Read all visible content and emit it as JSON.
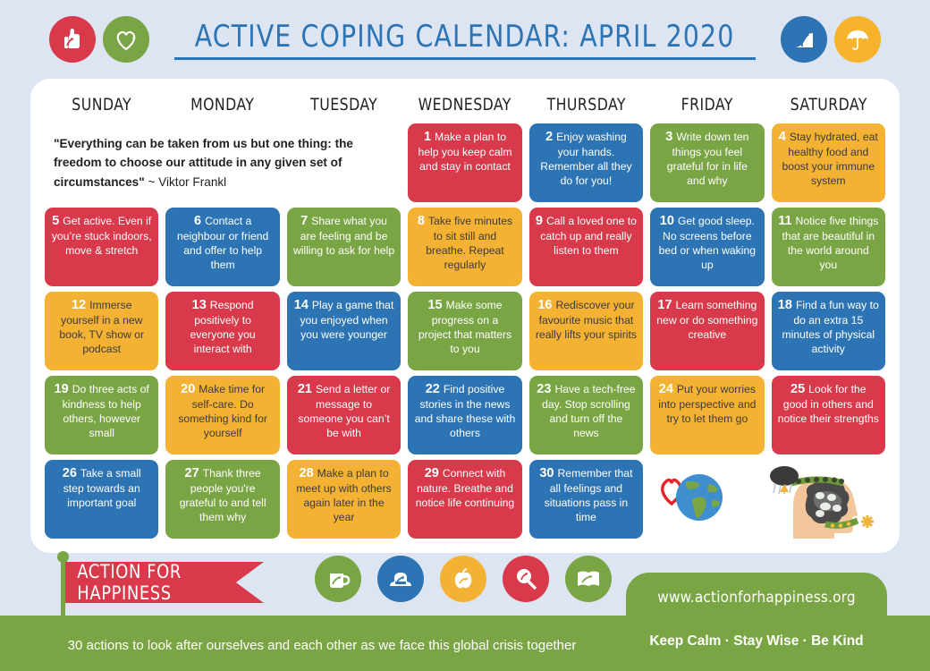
{
  "header": {
    "title": "ACTIVE COPING CALENDAR: APRIL 2020",
    "left_icons": [
      {
        "name": "thumbs-up-icon",
        "color": "#d8394b"
      },
      {
        "name": "heart-icon",
        "color": "#7aa545"
      }
    ],
    "right_icons": [
      {
        "name": "road-path-icon",
        "color": "#2d74b5"
      },
      {
        "name": "umbrella-icon",
        "color": "#f7b32b"
      }
    ]
  },
  "calendar": {
    "daynames": [
      "SUNDAY",
      "MONDAY",
      "TUESDAY",
      "WEDNESDAY",
      "THURSDAY",
      "FRIDAY",
      "SATURDAY"
    ],
    "quote": {
      "text": "\"Everything can be taken from us but one thing: the freedom to choose our attitude in any given set of circumstances\"",
      "author": "~ Viktor Frankl"
    },
    "days": [
      {
        "num": "1",
        "text": "Make a plan to help you keep calm and stay in contact",
        "color": "red"
      },
      {
        "num": "2",
        "text": "Enjoy washing your hands. Remember all they do for you!",
        "color": "blue"
      },
      {
        "num": "3",
        "text": "Write down ten things you feel grateful for in life and why",
        "color": "green"
      },
      {
        "num": "4",
        "text": "Stay hydrated, eat healthy food and boost your immune system",
        "color": "amber"
      },
      {
        "num": "5",
        "text": "Get active. Even if you’re stuck indoors, move & stretch",
        "color": "red"
      },
      {
        "num": "6",
        "text": "Contact a neighbour or friend and offer to help them",
        "color": "blue"
      },
      {
        "num": "7",
        "text": "Share what you are feeling and be willing to ask for help",
        "color": "green"
      },
      {
        "num": "8",
        "text": "Take five minutes to sit still and breathe. Repeat regularly",
        "color": "amber"
      },
      {
        "num": "9",
        "text": "Call a loved one to catch up and really listen to them",
        "color": "red"
      },
      {
        "num": "10",
        "text": "Get good sleep. No screens before bed or when waking up",
        "color": "blue"
      },
      {
        "num": "11",
        "text": "Notice five things that are beautiful in the world around you",
        "color": "green"
      },
      {
        "num": "12",
        "text": "Immerse yourself in a new book, TV show or podcast",
        "color": "amber"
      },
      {
        "num": "13",
        "text": "Respond positively to everyone you interact with",
        "color": "red"
      },
      {
        "num": "14",
        "text": "Play a game that you enjoyed when you were younger",
        "color": "blue"
      },
      {
        "num": "15",
        "text": "Make some progress on a project that matters to you",
        "color": "green"
      },
      {
        "num": "16",
        "text": "Rediscover your favourite music that really lifts your spirits",
        "color": "amber"
      },
      {
        "num": "17",
        "text": "Learn something new or do something creative",
        "color": "red"
      },
      {
        "num": "18",
        "text": "Find a fun way to do an extra 15 minutes of physical activity",
        "color": "blue"
      },
      {
        "num": "19",
        "text": "Do three acts of kindness to help others, however small",
        "color": "green"
      },
      {
        "num": "20",
        "text": "Make time for self-care. Do something kind for yourself",
        "color": "amber"
      },
      {
        "num": "21",
        "text": "Send a letter or message to someone you can’t be with",
        "color": "red"
      },
      {
        "num": "22",
        "text": "Find positive stories in the news and share these with others",
        "color": "blue"
      },
      {
        "num": "23",
        "text": "Have a tech-free day. Stop scrolling and turn off the news",
        "color": "green"
      },
      {
        "num": "24",
        "text": "Put your worries into perspective and try to let them go",
        "color": "amber"
      },
      {
        "num": "25",
        "text": "Look for the good in others and notice their strengths",
        "color": "red"
      },
      {
        "num": "26",
        "text": "Take a small step towards an important goal",
        "color": "blue"
      },
      {
        "num": "27",
        "text": "Thank three people you're grateful to and tell them why",
        "color": "green"
      },
      {
        "num": "28",
        "text": "Make a plan to meet up with others again later in the year",
        "color": "amber"
      },
      {
        "num": "29",
        "text": "Connect with nature. Breathe and notice life continuing",
        "color": "red"
      },
      {
        "num": "30",
        "text": "Remember that all feelings and situations pass in time",
        "color": "blue"
      }
    ],
    "illustrations": [
      {
        "name": "heart-globe-icon"
      },
      {
        "name": "head-brain-weather-icon"
      }
    ]
  },
  "footer": {
    "brand": "ACTION FOR HAPPINESS",
    "icons": [
      {
        "name": "mug-icon",
        "color": "#7aa545"
      },
      {
        "name": "telephone-icon",
        "color": "#2d74b5"
      },
      {
        "name": "apple-icon",
        "color": "#f4b234"
      },
      {
        "name": "magnifier-icon",
        "color": "#d8394b"
      },
      {
        "name": "book-icon",
        "color": "#7aa545"
      }
    ],
    "url": "www.actionforhappiness.org",
    "tagline": "Keep Calm · Stay Wise · Be Kind",
    "strapline": "30 actions to look after ourselves and each other as we face this global crisis together"
  },
  "colors": {
    "red": "#d8394b",
    "blue": "#2d74b5",
    "green": "#7aa545",
    "amber": "#f4b234",
    "page_bg": "#dde5f2",
    "card_bg": "#ffffff"
  }
}
